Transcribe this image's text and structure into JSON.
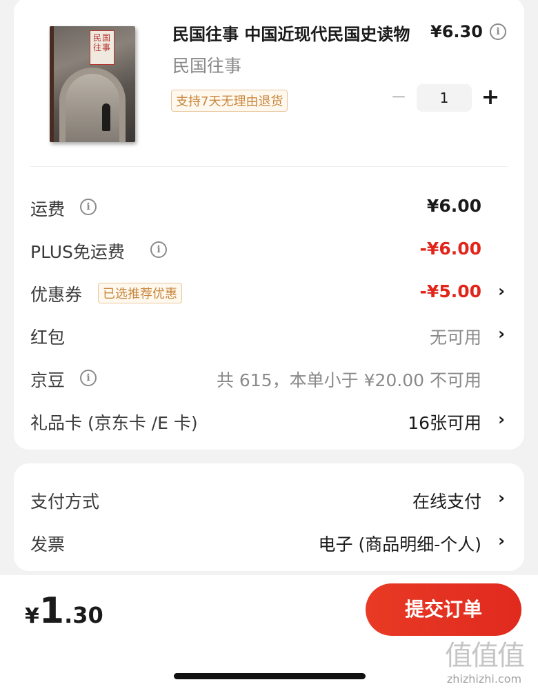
{
  "product": {
    "title": "民国往事 中国近现代民国史读物",
    "subtitle": "民国往事",
    "price": "¥6.30",
    "return_tag": "支持7天无理由退货",
    "qty_minus": "−",
    "quantity": "1",
    "qty_plus": "+",
    "cover_title": "民国往事"
  },
  "fees": [
    {
      "label": "运费",
      "value": "¥6.00"
    },
    {
      "label": "PLUS免运费",
      "value": "-¥6.00"
    },
    {
      "label": "优惠券",
      "tag": "已选推荐优惠",
      "value": "-¥5.00"
    },
    {
      "label": "红包",
      "value": "无可用"
    },
    {
      "label": "京豆",
      "value": "共 615，本单小于 ¥20.00 不可用"
    },
    {
      "label": "礼品卡 (京东卡 /E 卡)",
      "value": "16张可用"
    }
  ],
  "payment": {
    "method_label": "支付方式",
    "method_value": "在线支付",
    "invoice_label": "发票",
    "invoice_value": "电子 (商品明细-个人)"
  },
  "footer": {
    "currency": "¥",
    "total_int": "1",
    "total_dec": ".30",
    "submit_label": "提交订单"
  },
  "watermark": {
    "glyphs": "值值值",
    "text": "zhizhizhi.com"
  },
  "glyphs": {
    "info": "i",
    "chevron": "›"
  },
  "colors": {
    "accent_red": "#e1251b",
    "button_red": "#e83a25",
    "tag_orange": "#c8873c",
    "background": "#f2f2f2"
  }
}
